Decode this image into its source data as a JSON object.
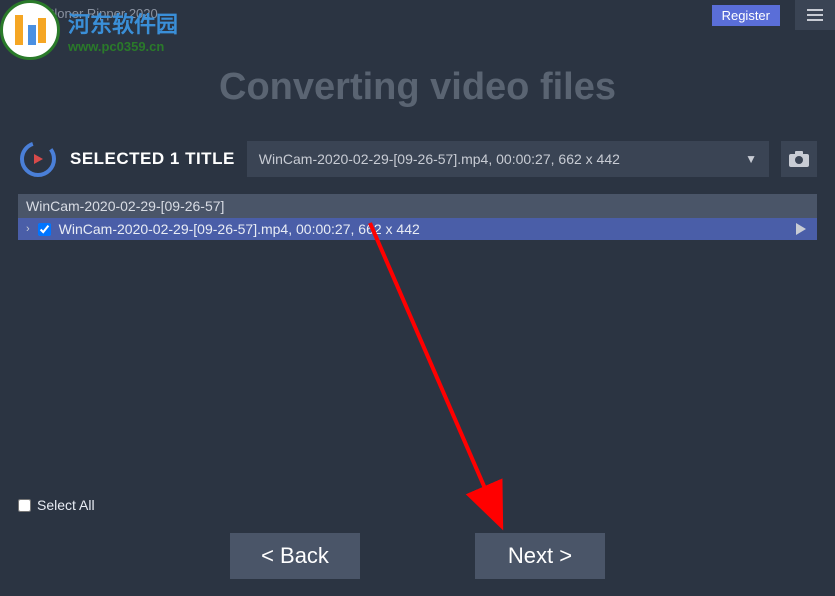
{
  "titlebar": {
    "app_title": "Cloner Ripper 2020",
    "register_label": "Register"
  },
  "watermark": {
    "cn_text": "河东软件园",
    "url": "www.pc0359.cn"
  },
  "heading": "Converting video files",
  "selection": {
    "selected_label": "SELECTED 1 TITLE",
    "dropdown_text": "WinCam-2020-02-29-[09-26-57].mp4, 00:00:27, 662 x 442"
  },
  "file_list": {
    "group_header": "WinCam-2020-02-29-[09-26-57]",
    "items": [
      {
        "checked": true,
        "label": "WinCam-2020-02-29-[09-26-57].mp4, 00:00:27, 662 x 442"
      }
    ]
  },
  "select_all": {
    "label": "Select All",
    "checked": false
  },
  "buttons": {
    "back": "<  Back",
    "next": "Next  >"
  }
}
